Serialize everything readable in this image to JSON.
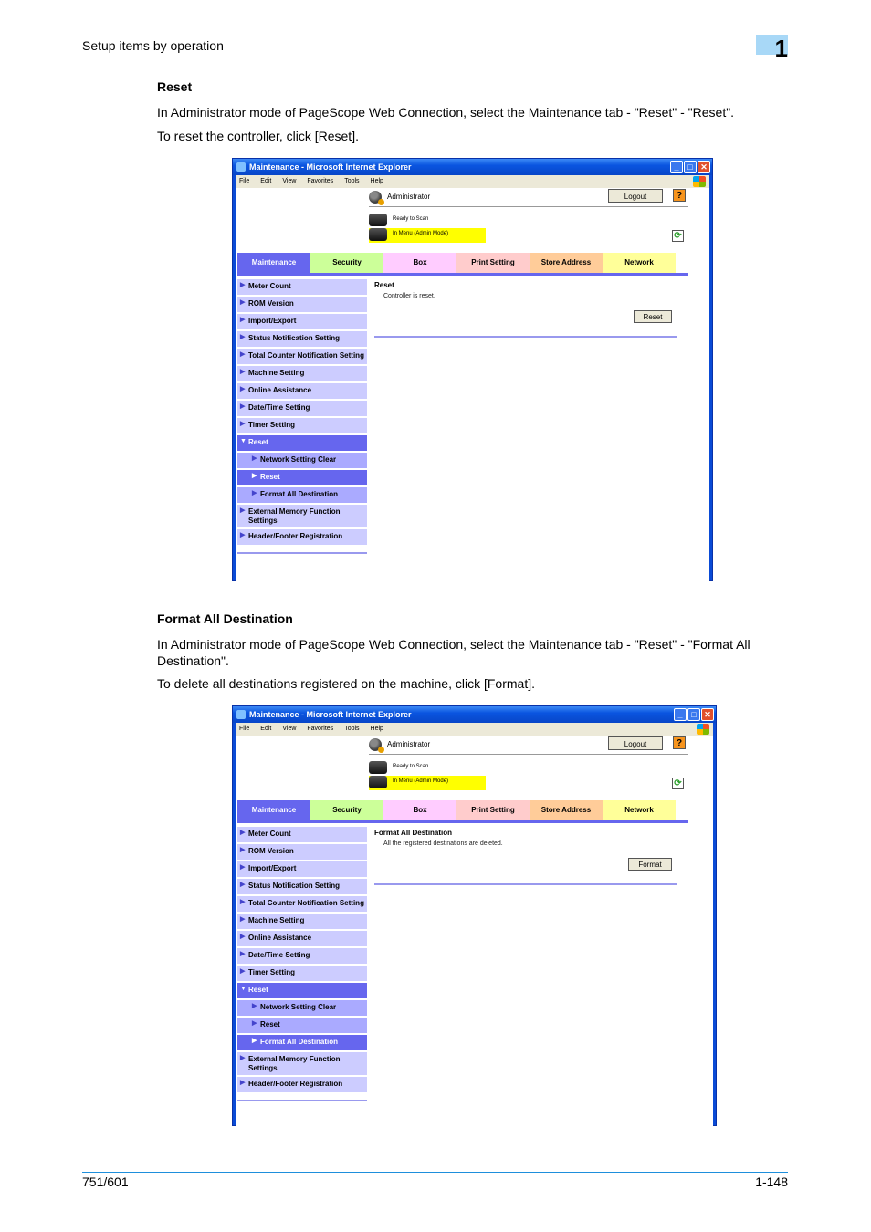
{
  "header": {
    "title": "Setup items by operation",
    "chapter": "1"
  },
  "sections": [
    {
      "title": "Reset",
      "paragraphs": [
        "In Administrator mode of PageScope Web Connection, select the Maintenance tab - \"Reset\" - \"Reset\".",
        "To reset the controller, click [Reset]."
      ],
      "window": {
        "title": "Maintenance - Microsoft Internet Explorer",
        "menu": [
          "File",
          "Edit",
          "View",
          "Favorites",
          "Tools",
          "Help"
        ],
        "user_label": "Administrator",
        "logout_label": "Logout",
        "help_label": "?",
        "status_1": "Ready to Scan",
        "status_2": "In Menu (Admin Mode)",
        "tabs": [
          {
            "label": "Maintenance",
            "color": "#6666ee"
          },
          {
            "label": "Security",
            "color": "#ccff99"
          },
          {
            "label": "Box",
            "color": "#ffccff"
          },
          {
            "label": "Print Setting",
            "color": "#ffcccc"
          },
          {
            "label": "Store Address",
            "color": "#ffcc99"
          },
          {
            "label": "Network",
            "color": "#ffff99"
          }
        ],
        "nav": [
          {
            "label": "Meter Count"
          },
          {
            "label": "ROM Version"
          },
          {
            "label": "Import/Export"
          },
          {
            "label": "Status Notification Setting"
          },
          {
            "label": "Total Counter Notification Setting"
          },
          {
            "label": "Machine Setting"
          },
          {
            "label": "Online Assistance"
          },
          {
            "label": "Date/Time Setting"
          },
          {
            "label": "Timer Setting"
          },
          {
            "label": "Reset"
          },
          {
            "label": "Network Setting Clear"
          },
          {
            "label": "Reset"
          },
          {
            "label": "Format All Destination"
          },
          {
            "label": "External Memory Function Settings"
          },
          {
            "label": "Header/Footer Registration"
          }
        ],
        "main_title": "Reset",
        "main_message": "Controller is reset.",
        "action_label": "Reset"
      }
    },
    {
      "title": "Format All Destination",
      "paragraphs": [
        "In Administrator mode of PageScope Web Connection, select the Maintenance tab - \"Reset\" - \"Format All Destination\".",
        "To delete all destinations registered on the machine, click [Format]."
      ],
      "window": {
        "title": "Maintenance - Microsoft Internet Explorer",
        "menu": [
          "File",
          "Edit",
          "View",
          "Favorites",
          "Tools",
          "Help"
        ],
        "user_label": "Administrator",
        "logout_label": "Logout",
        "help_label": "?",
        "status_1": "Ready to Scan",
        "status_2": "In Menu (Admin Mode)",
        "tabs": [
          {
            "label": "Maintenance",
            "color": "#6666ee"
          },
          {
            "label": "Security",
            "color": "#ccff99"
          },
          {
            "label": "Box",
            "color": "#ffccff"
          },
          {
            "label": "Print Setting",
            "color": "#ffcccc"
          },
          {
            "label": "Store Address",
            "color": "#ffcc99"
          },
          {
            "label": "Network",
            "color": "#ffff99"
          }
        ],
        "nav": [
          {
            "label": "Meter Count"
          },
          {
            "label": "ROM Version"
          },
          {
            "label": "Import/Export"
          },
          {
            "label": "Status Notification Setting"
          },
          {
            "label": "Total Counter Notification Setting"
          },
          {
            "label": "Machine Setting"
          },
          {
            "label": "Online Assistance"
          },
          {
            "label": "Date/Time Setting"
          },
          {
            "label": "Timer Setting"
          },
          {
            "label": "Reset"
          },
          {
            "label": "Network Setting Clear"
          },
          {
            "label": "Reset"
          },
          {
            "label": "Format All Destination"
          },
          {
            "label": "External Memory Function Settings"
          },
          {
            "label": "Header/Footer Registration"
          }
        ],
        "main_title": "Format All Destination",
        "main_message": "All the registered destinations are deleted.",
        "action_label": "Format"
      }
    }
  ],
  "footer": {
    "left": "751/601",
    "right": "1-148"
  }
}
